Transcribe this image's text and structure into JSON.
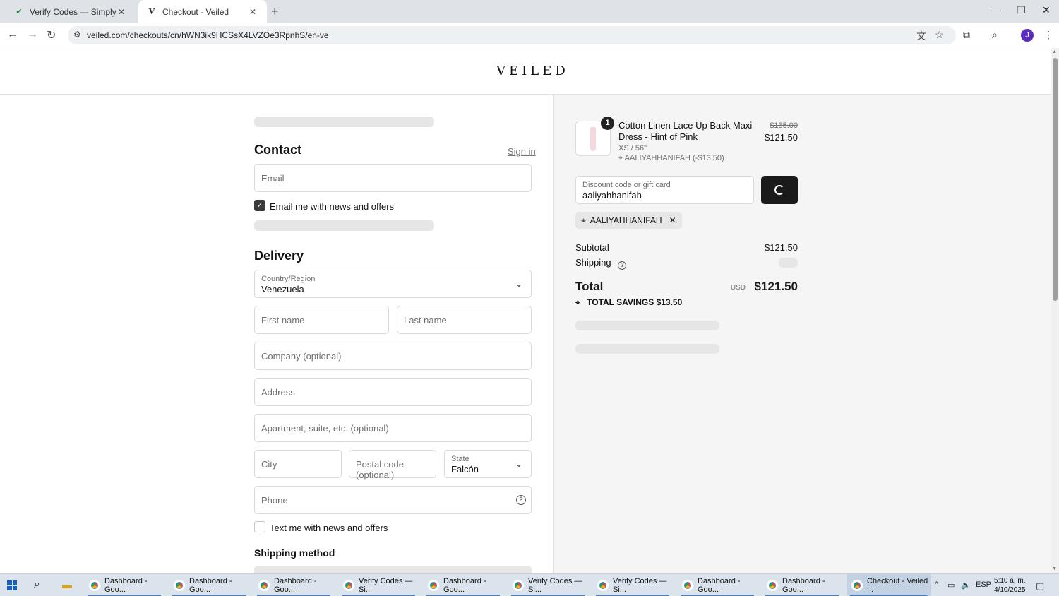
{
  "browser": {
    "tabs": [
      {
        "title": "Verify Codes — SimplyCodes",
        "active": false
      },
      {
        "title": "Checkout - Veiled",
        "active": true
      }
    ],
    "url": "veiled.com/checkouts/cn/hWN3ik9HCSsX4LVZOe3RpnhS/en-ve",
    "profile_initial": "J"
  },
  "store": {
    "logo": "VEILED"
  },
  "contact": {
    "heading": "Contact",
    "sign_in": "Sign in",
    "email_placeholder": "Email",
    "email_offers": "Email me with news and offers",
    "email_offers_checked": true
  },
  "delivery": {
    "heading": "Delivery",
    "country_label": "Country/Region",
    "country_value": "Venezuela",
    "first_name": "First name",
    "last_name": "Last name",
    "company": "Company (optional)",
    "address": "Address",
    "apartment": "Apartment, suite, etc. (optional)",
    "city": "City",
    "postal": "Postal code (optional)",
    "state_label": "State",
    "state_value": "Falcón",
    "phone": "Phone",
    "text_offers": "Text me with news and offers",
    "text_offers_checked": false,
    "shipping_method": "Shipping method"
  },
  "summary": {
    "qty": "1",
    "product_name": "Cotton Linen Lace Up Back Maxi Dress - Hint of Pink",
    "variant": "XS / 56\"",
    "line_discount": "AALIYAHHANIFAH (-$13.50)",
    "original_price": "$135.00",
    "price": "$121.50",
    "discount_label": "Discount code or gift card",
    "discount_value": "aaliyahhanifah",
    "applied_code": "AALIYAHHANIFAH",
    "subtotal_label": "Subtotal",
    "subtotal": "$121.50",
    "shipping_label": "Shipping",
    "total_label": "Total",
    "currency": "USD",
    "total": "$121.50",
    "savings_label": "TOTAL SAVINGS",
    "savings": "$13.50"
  },
  "taskbar": {
    "items": [
      "Dashboard - Goo...",
      "Dashboard - Goo...",
      "Dashboard - Goo...",
      "Verify Codes — Si...",
      "Dashboard - Goo...",
      "Verify Codes — Si...",
      "Verify Codes — Si...",
      "Dashboard - Goo...",
      "Dashboard - Goo...",
      "Checkout - Veiled ..."
    ],
    "lang": "ESP",
    "time": "5:10 a. m.",
    "date": "4/10/2025"
  }
}
